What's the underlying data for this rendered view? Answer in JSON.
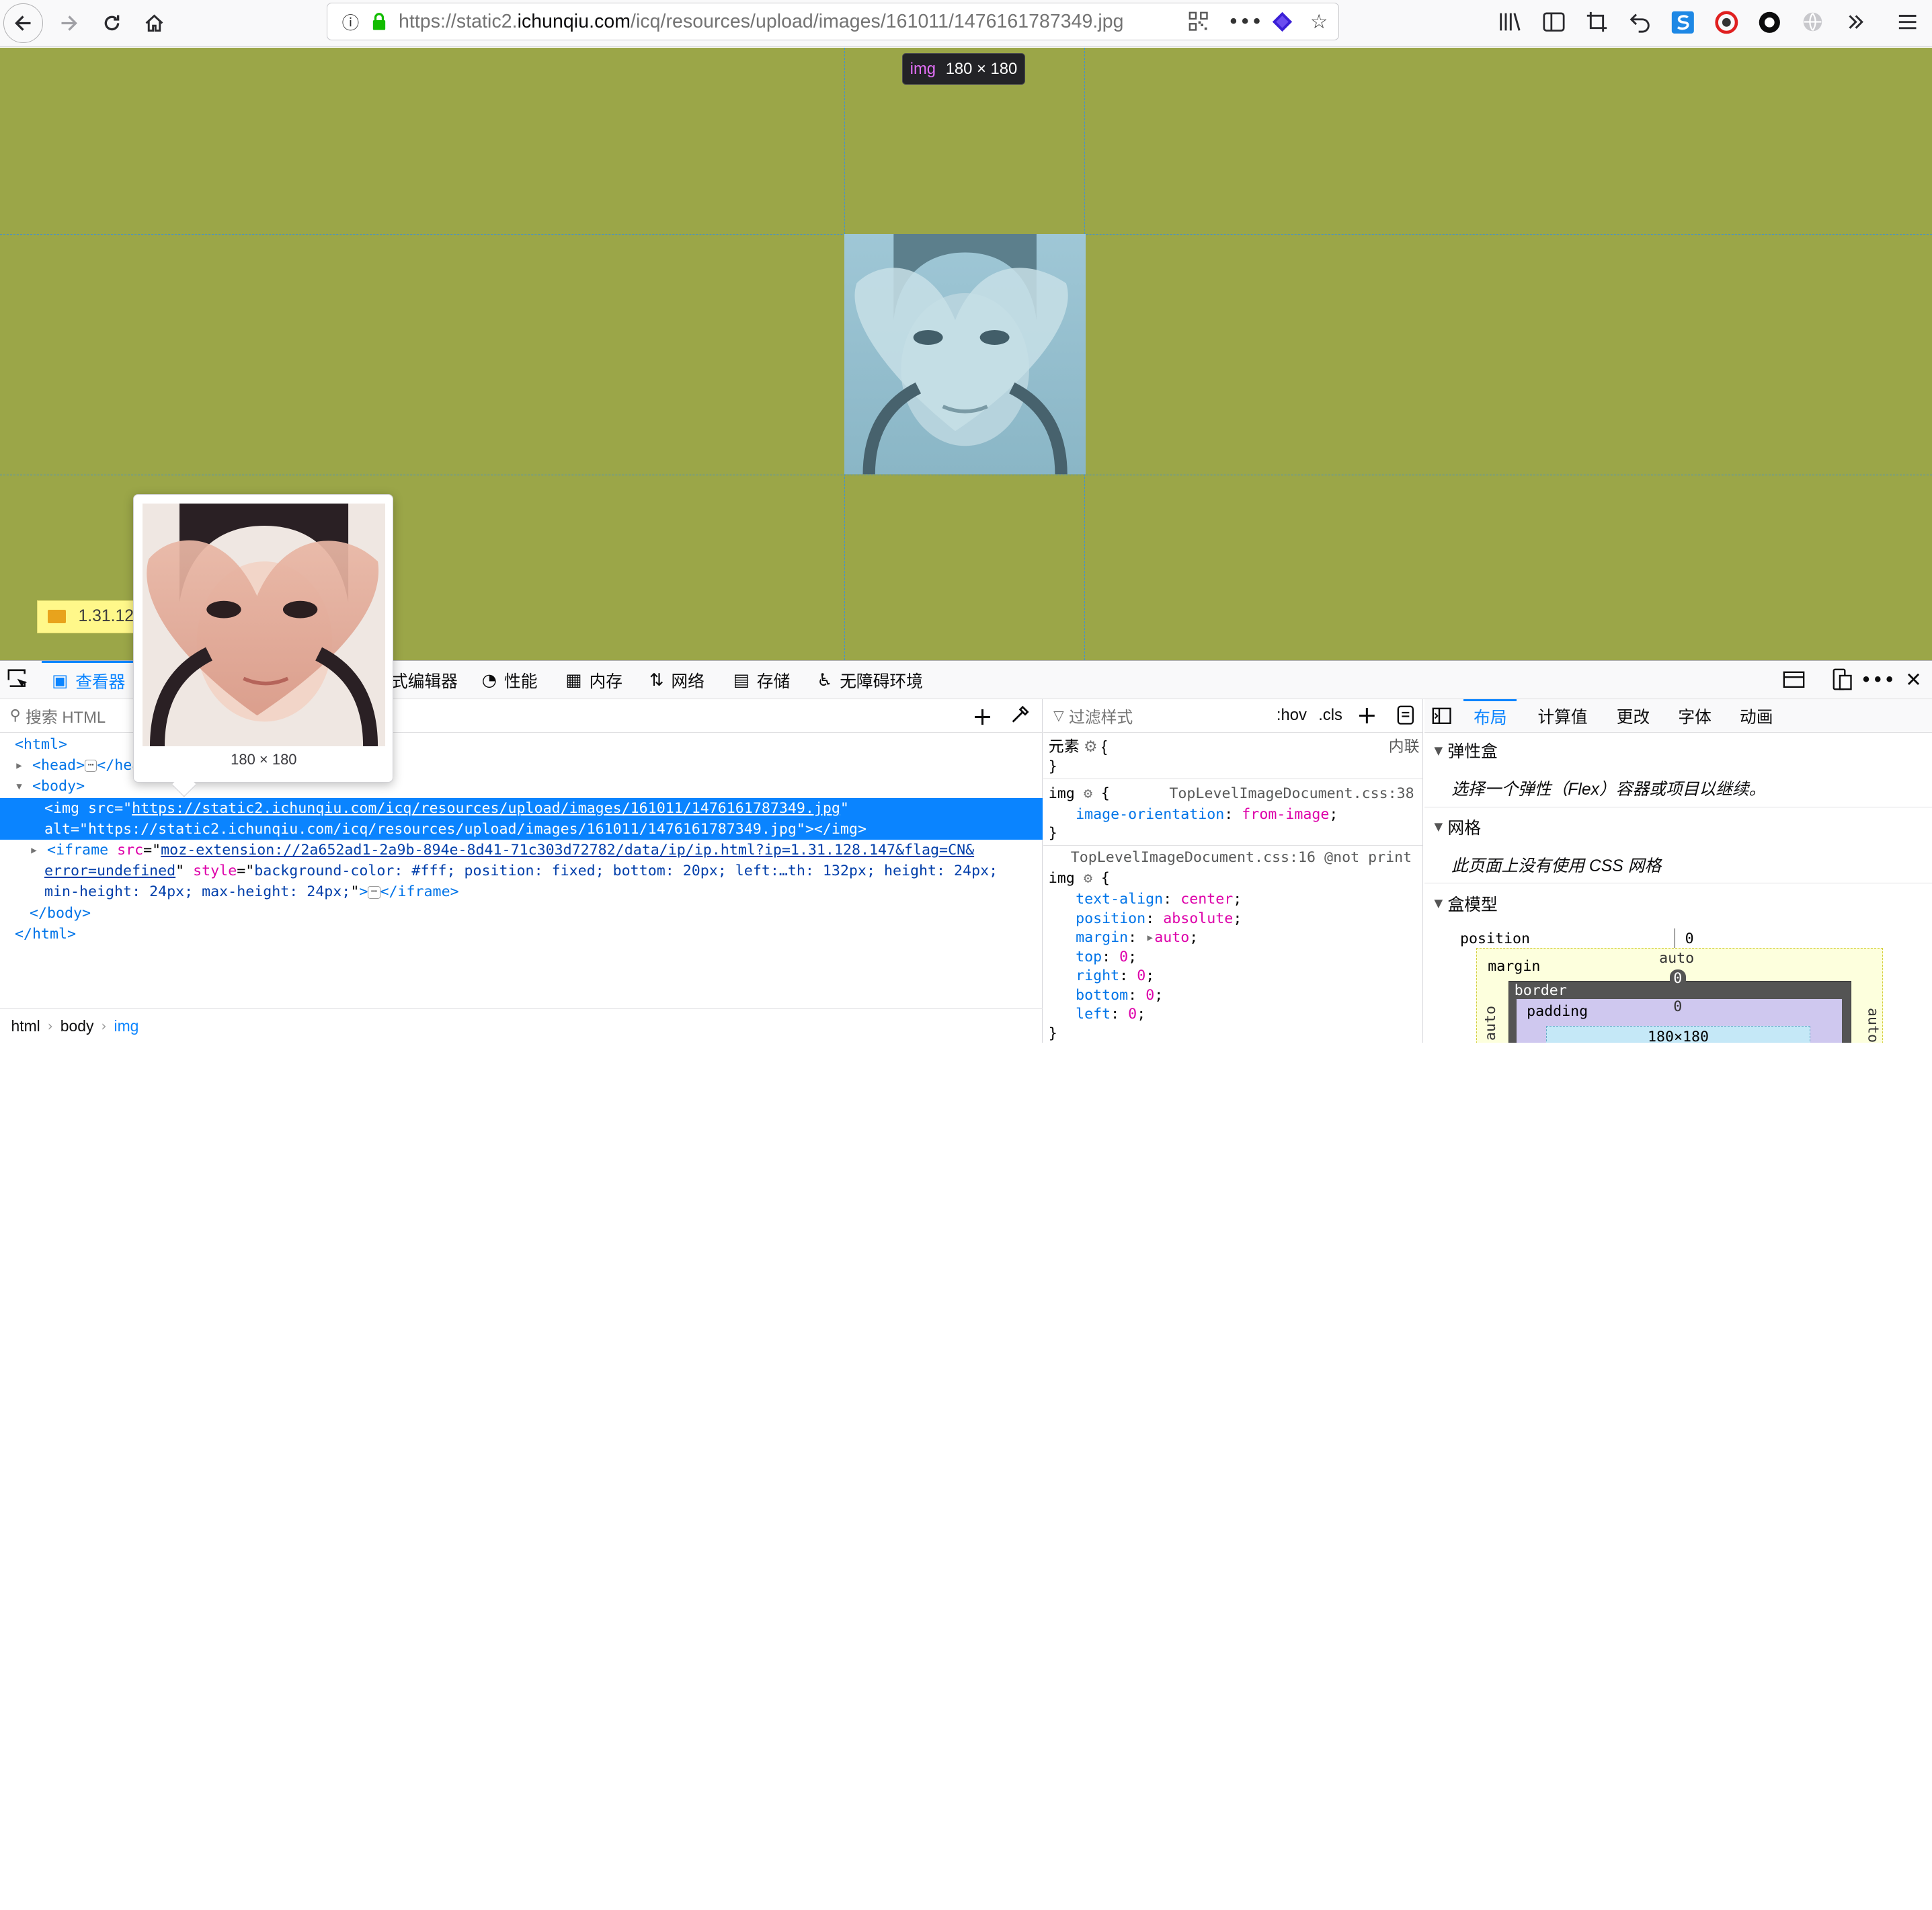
{
  "browser": {
    "url_prefix": "https://static2.",
    "url_domain": "ichunqiu.com",
    "url_path": "/icq/resources/upload/images/161011/1476161787349.jpg",
    "icons": {
      "back": "back-arrow-icon",
      "forward": "forward-arrow-icon",
      "reload": "reload-icon",
      "home": "home-icon",
      "info": "info-icon",
      "lock": "lock-icon",
      "qr": "qr-code-icon",
      "more": "more-icon",
      "pocket": "pocket-icon",
      "bookmark": "star-icon",
      "library": "library-icon",
      "sidebar": "sidebar-icon",
      "screenshot": "crop-icon",
      "undo": "undo-icon",
      "ext1": "extension-s-icon",
      "ext2": "extension-red-icon",
      "ext3": "extension-circle-icon",
      "ext4": "extension-globe-icon",
      "overflow": "chevrons-right-icon",
      "menu": "hamburger-menu-icon"
    }
  },
  "viewport": {
    "background_color": "#9ba648",
    "infobar_tag": "img",
    "infobar_size": "180 × 180",
    "ip_widget_text": "1.31.12"
  },
  "devtools": {
    "tabs": {
      "inspector": "查看器",
      "style_editor": "样式编辑器",
      "performance": "性能",
      "memory": "内存",
      "network": "网络",
      "storage": "存储",
      "accessibility": "无障碍环境"
    },
    "markup": {
      "search_placeholder": "搜索 HTML",
      "lines": {
        "html_open": "<html>",
        "head_open": "<head>",
        "head_close": "</head>",
        "body_open": "<body>",
        "img_tag": "img",
        "img_src_attr": "src",
        "img_src_val": "https://static2.ichunqiu.com/icq/resources/upload/images/161011/1476161787349.jpg",
        "img_alt_attr": "alt",
        "img_alt_val": "https://static2.ichunqiu.com/icq/resources/upload/images/161011/1476161787349.jpg",
        "iframe_tag": "iframe",
        "iframe_src_attr": "src",
        "iframe_src_val_1": "moz-extension://2a652ad1-2a9b-894e-8d41-71c303d72782/data/ip/ip.html?ip=1.31.128.147&flag=CN&",
        "iframe_src_val_2": "error=undefined",
        "iframe_style_attr": "style",
        "iframe_style_val_1": "background-color: #fff; position: fixed; bottom: 20px; left:…th: 132px; height: 24px;",
        "iframe_style_val_2": "min-height: 24px; max-height: 24px;",
        "iframe_close": "</iframe>",
        "body_close": "</body>",
        "html_close": "</html>"
      },
      "breadcrumbs": [
        "html",
        "body",
        "img"
      ]
    },
    "rules": {
      "filter_placeholder": "过滤样式",
      "hov": ":hov",
      "cls": ".cls",
      "element_label": "元素",
      "inline_label": "内联",
      "rule1_selector": "img",
      "rule1_source": "TopLevelImageDocument.css:38",
      "rule1_prop": "image-orientation",
      "rule1_val": "from-image",
      "rule2_source": "TopLevelImageDocument.css:16 @not print",
      "rule2_selector": "img",
      "rule2_decls": [
        {
          "prop": "text-align",
          "val": "center"
        },
        {
          "prop": "position",
          "val": "absolute"
        },
        {
          "prop": "margin",
          "val": "auto"
        },
        {
          "prop": "top",
          "val": "0"
        },
        {
          "prop": "right",
          "val": "0"
        },
        {
          "prop": "bottom",
          "val": "0"
        },
        {
          "prop": "left",
          "val": "0"
        }
      ]
    },
    "layout": {
      "tabs": {
        "layout": "布局",
        "computed": "计算值",
        "changes": "更改",
        "fonts": "字体",
        "animations": "动画"
      },
      "flexbox_header": "弹性盒",
      "flexbox_text": "选择一个弹性（Flex）容器或项目以继续。",
      "grid_header": "网格",
      "grid_text": "此页面上没有使用 CSS 网格",
      "boxmodel_header": "盒模型",
      "position_label": "position",
      "position_value": "0",
      "margin_label": "margin",
      "margin_top": "auto",
      "border_label": "border",
      "border_top": "0",
      "padding_label": "padding",
      "padding_top": "0",
      "content_size": "180×180",
      "side_auto": "auto",
      "side_zero": "0"
    }
  },
  "preview": {
    "caption": "180 × 180"
  }
}
